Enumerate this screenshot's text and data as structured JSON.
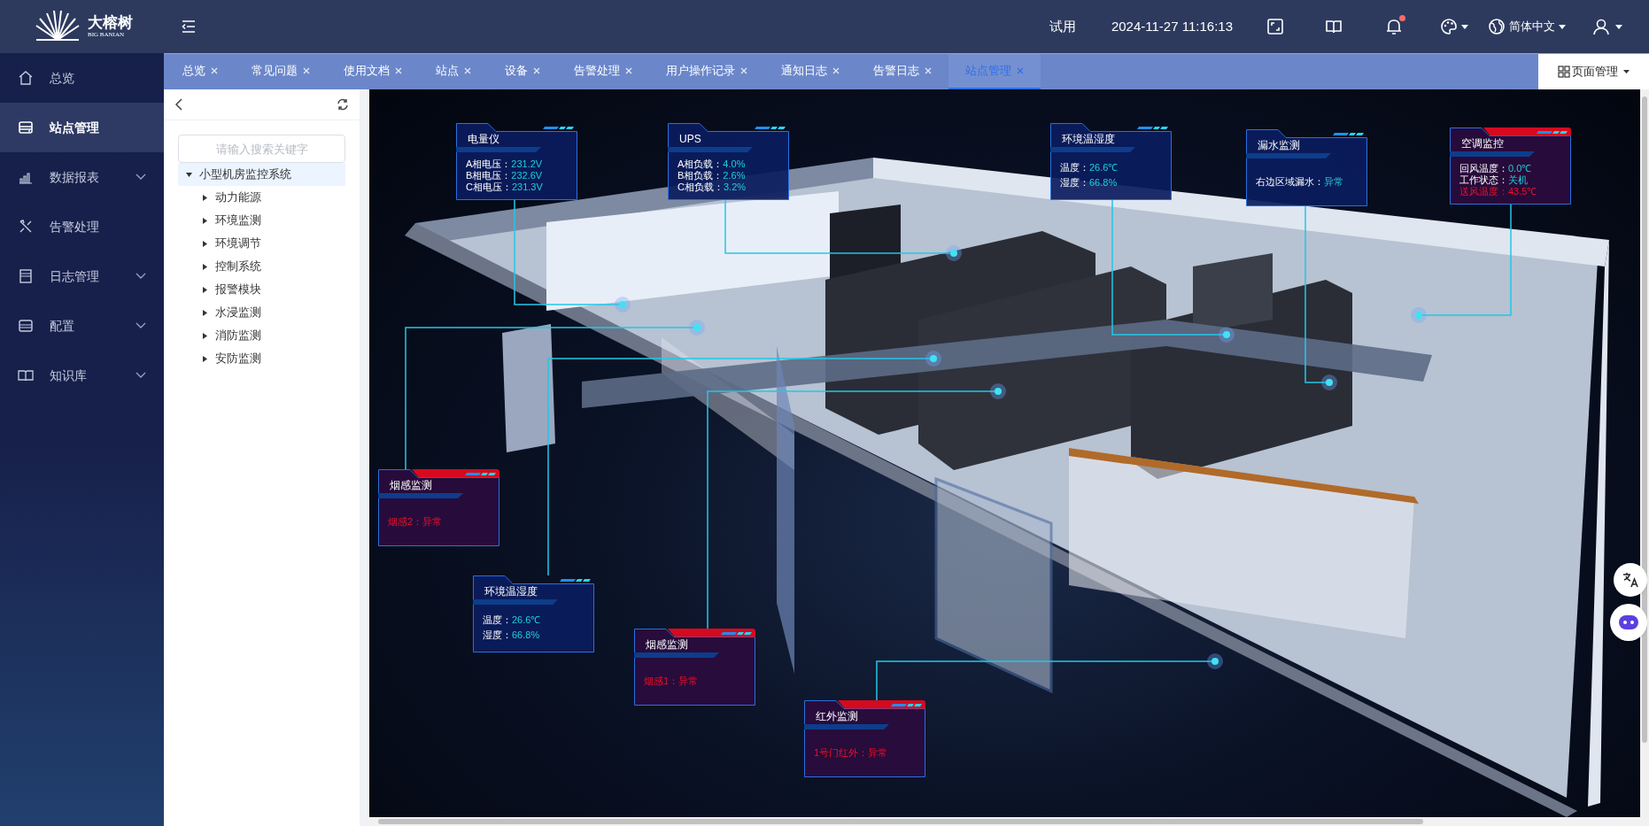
{
  "header": {
    "logo_text": "大榕树",
    "logo_subtitle": "BIG BANIAN",
    "trial": "试用",
    "datetime": "2024-11-27 11:16:13",
    "language": "简体中文",
    "notification_dot": true
  },
  "sidebar": {
    "items": [
      {
        "label": "总览",
        "selected": false,
        "expandable": false
      },
      {
        "label": "站点管理",
        "selected": true,
        "expandable": false
      },
      {
        "label": "数据报表",
        "selected": false,
        "expandable": true
      },
      {
        "label": "告警处理",
        "selected": false,
        "expandable": false
      },
      {
        "label": "日志管理",
        "selected": false,
        "expandable": true
      },
      {
        "label": "配置",
        "selected": false,
        "expandable": true
      },
      {
        "label": "知识库",
        "selected": false,
        "expandable": true
      }
    ]
  },
  "tabs": [
    {
      "label": "总览",
      "selected": false
    },
    {
      "label": "常见问题",
      "selected": false
    },
    {
      "label": "使用文档",
      "selected": false
    },
    {
      "label": "站点",
      "selected": false
    },
    {
      "label": "设备",
      "selected": false
    },
    {
      "label": "告警处理",
      "selected": false
    },
    {
      "label": "用户操作记录",
      "selected": false
    },
    {
      "label": "通知日志",
      "selected": false
    },
    {
      "label": "告警日志",
      "selected": false
    },
    {
      "label": "站点管理",
      "selected": true
    }
  ],
  "page_manage": "页面管理",
  "tree": {
    "search": {
      "placeholder": "请输入搜索关键字"
    },
    "root": {
      "label": "小型机房监控系统",
      "expanded": true,
      "selected": true,
      "children": [
        {
          "label": "动力能源",
          "expanded": false
        },
        {
          "label": "环境监测",
          "expanded": false
        },
        {
          "label": "环境调节",
          "expanded": false
        },
        {
          "label": "控制系统",
          "expanded": false
        },
        {
          "label": "报警模块",
          "expanded": false
        },
        {
          "label": "水浸监测",
          "expanded": false
        },
        {
          "label": "消防监测",
          "expanded": false
        },
        {
          "label": "安防监测",
          "expanded": false
        }
      ]
    }
  },
  "cards": [
    {
      "title": "电量仪",
      "alarm": false,
      "rows": [
        {
          "label": "A相电压：",
          "value": "231.2V",
          "alarm": false
        },
        {
          "label": "B相电压：",
          "value": "232.6V",
          "alarm": false
        },
        {
          "label": "C相电压：",
          "value": "231.3V",
          "alarm": false
        }
      ]
    },
    {
      "title": "UPS",
      "alarm": false,
      "rows": [
        {
          "label": "A相负载：",
          "value": "4.0%",
          "alarm": false
        },
        {
          "label": "B相负载：",
          "value": "2.6%",
          "alarm": false
        },
        {
          "label": "C相负载：",
          "value": "3.2%",
          "alarm": false
        }
      ]
    },
    {
      "title": "环境温湿度",
      "alarm": false,
      "rows": [
        {
          "label": "温度：",
          "value": "26.6℃",
          "alarm": false
        },
        {
          "label": "湿度：",
          "value": "66.8%",
          "alarm": false
        }
      ]
    },
    {
      "title": "漏水监测",
      "alarm": false,
      "rows": [
        {
          "label": "右边区域漏水：",
          "value": "异常",
          "alarm": false
        }
      ]
    },
    {
      "title": "空调监控",
      "alarm": true,
      "rows": [
        {
          "label": "回风温度：",
          "value": "0.0℃",
          "alarm": false
        },
        {
          "label": "工作状态：",
          "value": "关机",
          "alarm": false
        },
        {
          "label": "送风温度：",
          "value": "43.5℃",
          "alarm": true
        }
      ]
    },
    {
      "title": "烟感监测",
      "alarm": true,
      "rows": [
        {
          "label": "烟感2：",
          "value": "异常",
          "alarm": true
        }
      ]
    },
    {
      "title": "环境温湿度",
      "alarm": false,
      "rows": [
        {
          "label": "温度：",
          "value": "26.6℃",
          "alarm": false
        },
        {
          "label": "湿度：",
          "value": "66.8%",
          "alarm": false
        }
      ]
    },
    {
      "title": "烟感监测",
      "alarm": true,
      "rows": [
        {
          "label": "烟感1：",
          "value": "异常",
          "alarm": true
        }
      ]
    },
    {
      "title": "红外监测",
      "alarm": true,
      "rows": [
        {
          "label": "1号门红外：",
          "value": "异常",
          "alarm": true
        }
      ]
    }
  ]
}
